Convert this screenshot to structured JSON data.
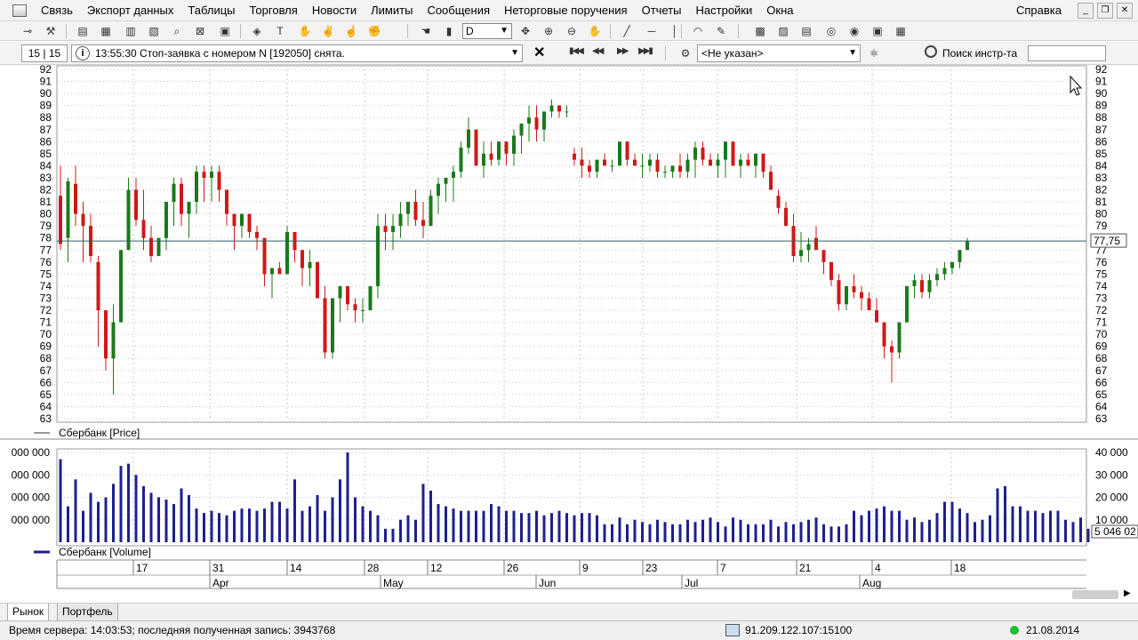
{
  "menu": {
    "items": [
      "Связь",
      "Экспорт данных",
      "Таблицы",
      "Торговля",
      "Новости",
      "Лимиты",
      "Сообщения",
      "Неторговые поручения",
      "Отчеты",
      "Настройки",
      "Окна"
    ],
    "help": "Справка"
  },
  "toolbar": {
    "timeframe": "D"
  },
  "toolbar2": {
    "counter": "15 | 15",
    "message": "13:55:30 Стоп-заявка с номером N [192050] снята.",
    "trader_select": "<Не указан>",
    "search_label": "Поиск инстр-та",
    "search_value": ""
  },
  "colors": {
    "bull": "#1a7a1a",
    "bear": "#d01818",
    "volume": "#1f1f8f",
    "grid": "#c8c8c8",
    "price_line": "#2f5f5f"
  },
  "chart_data": [
    {
      "type": "candlestick",
      "title": "Сбербанк [Price]",
      "ylim": [
        63,
        92
      ],
      "y_ticks": [
        63,
        64,
        65,
        66,
        67,
        68,
        69,
        70,
        71,
        72,
        73,
        74,
        75,
        76,
        77,
        78,
        79,
        80,
        81,
        82,
        83,
        84,
        85,
        86,
        87,
        88,
        89,
        90,
        91,
        92
      ],
      "current_price_label": "77,75",
      "current_price": 77.75,
      "ohlc": [
        [
          81.5,
          84,
          77,
          77.5
        ],
        [
          78,
          83,
          76,
          82.7
        ],
        [
          82.5,
          84,
          79,
          80
        ],
        [
          80,
          81,
          76,
          79
        ],
        [
          79,
          80,
          76,
          76.5
        ],
        [
          76,
          76.5,
          69,
          72
        ],
        [
          72,
          72,
          67,
          68
        ],
        [
          68,
          72.5,
          65,
          71
        ],
        [
          71,
          77,
          71,
          77
        ],
        [
          77,
          83,
          77,
          82
        ],
        [
          82,
          83,
          79,
          79.5
        ],
        [
          79.5,
          82,
          77,
          78
        ],
        [
          78,
          79,
          76,
          76.5
        ],
        [
          76.5,
          78,
          77,
          78
        ],
        [
          78,
          81,
          77,
          81
        ],
        [
          81,
          83,
          79,
          82.5
        ],
        [
          82.5,
          83,
          79,
          80
        ],
        [
          80,
          81,
          78,
          81
        ],
        [
          81,
          84,
          80,
          83.5
        ],
        [
          83.5,
          84,
          81,
          83
        ],
        [
          83,
          84,
          81,
          83.5
        ],
        [
          83.5,
          84,
          81,
          82
        ],
        [
          82,
          82,
          79,
          80
        ],
        [
          80,
          80,
          77,
          79
        ],
        [
          79,
          80,
          78,
          80
        ],
        [
          80,
          80,
          78,
          78.5
        ],
        [
          78.5,
          79,
          77,
          78
        ],
        [
          78,
          78,
          74,
          75
        ],
        [
          75,
          75.5,
          73,
          75.5
        ],
        [
          75.5,
          76,
          75,
          75
        ],
        [
          75,
          79,
          75,
          78.5
        ],
        [
          78.5,
          78.5,
          76,
          77
        ],
        [
          77,
          77,
          74,
          75.5
        ],
        [
          75.5,
          77,
          74,
          76
        ],
        [
          76,
          76,
          73,
          73
        ],
        [
          73,
          74,
          68,
          68.5
        ],
        [
          68.5,
          73,
          68,
          73
        ],
        [
          73,
          74,
          71,
          74
        ],
        [
          74,
          74,
          72,
          72.5
        ],
        [
          72.5,
          73,
          71,
          72
        ],
        [
          72,
          73,
          71,
          72
        ],
        [
          72,
          74,
          72,
          74
        ],
        [
          74,
          80,
          73,
          79
        ],
        [
          79,
          80,
          77,
          78.5
        ],
        [
          78.5,
          80,
          77,
          79
        ],
        [
          79,
          81,
          78,
          80
        ],
        [
          80,
          81,
          79,
          81
        ],
        [
          81,
          82,
          79,
          79.5
        ],
        [
          79.5,
          81,
          78,
          79
        ],
        [
          79,
          82,
          79,
          81.5
        ],
        [
          81.5,
          83,
          80,
          82.5
        ],
        [
          82.5,
          83,
          81,
          83
        ],
        [
          83,
          84,
          81,
          83.5
        ],
        [
          83.5,
          86,
          83,
          85.5
        ],
        [
          85.5,
          88,
          85,
          87
        ],
        [
          87,
          87,
          84,
          84
        ],
        [
          84,
          86,
          83,
          85
        ],
        [
          85,
          86,
          84,
          84.5
        ],
        [
          84.5,
          86,
          84,
          86
        ],
        [
          86,
          86,
          84,
          85
        ],
        [
          85,
          87,
          84,
          86.5
        ],
        [
          86.5,
          87,
          85,
          87.5
        ],
        [
          87.5,
          89,
          86,
          88
        ],
        [
          88,
          89,
          86,
          87
        ],
        [
          87,
          88,
          86,
          88.5
        ],
        [
          88.5,
          89.5,
          88,
          89
        ],
        [
          89,
          89,
          88,
          88.5
        ],
        [
          88.5,
          89,
          88,
          88.5
        ],
        [
          85,
          85.5,
          84,
          84.5
        ],
        [
          84.5,
          85.5,
          83,
          84
        ],
        [
          84,
          84.5,
          83,
          83.5
        ],
        [
          83.5,
          84,
          83,
          84.5
        ],
        [
          84.5,
          85,
          84,
          84
        ],
        [
          84,
          84.5,
          83.5,
          84
        ],
        [
          84,
          86,
          84,
          86
        ],
        [
          86,
          86,
          84,
          84.5
        ],
        [
          84.5,
          85,
          84,
          84
        ],
        [
          84,
          85,
          83,
          84
        ],
        [
          84,
          85,
          83.5,
          84.5
        ],
        [
          84.5,
          85,
          83,
          83.5
        ],
        [
          83.5,
          84,
          83,
          83.5
        ],
        [
          83.5,
          84,
          83,
          84
        ],
        [
          84,
          85,
          83,
          83.5
        ],
        [
          83.5,
          85,
          83,
          84.5
        ],
        [
          84.5,
          86,
          83,
          85.5
        ],
        [
          85.5,
          86,
          84,
          84.5
        ],
        [
          84.5,
          85,
          84,
          84
        ],
        [
          84,
          85,
          83,
          84.5
        ],
        [
          84.5,
          86,
          83,
          86
        ],
        [
          86,
          86,
          84,
          84
        ],
        [
          84,
          85,
          83,
          84.5
        ],
        [
          84.5,
          85,
          84,
          84
        ],
        [
          84,
          85,
          83,
          85
        ],
        [
          85,
          85,
          83,
          83.5
        ],
        [
          83.5,
          84,
          82,
          82
        ],
        [
          81.5,
          82,
          80,
          80.5
        ],
        [
          80.5,
          81,
          79,
          79
        ],
        [
          79,
          80,
          76,
          76.5
        ],
        [
          76.5,
          78.5,
          76,
          77
        ],
        [
          77,
          78,
          76,
          77.5
        ],
        [
          78,
          79,
          77,
          77
        ],
        [
          77,
          77,
          75,
          76
        ],
        [
          76,
          76,
          74,
          74.5
        ],
        [
          74.5,
          75,
          72,
          72.5
        ],
        [
          72.5,
          74,
          72,
          74
        ],
        [
          74,
          75,
          73,
          73.5
        ],
        [
          73.5,
          74,
          72,
          73
        ],
        [
          73,
          73.5,
          72,
          72
        ],
        [
          72,
          73,
          71,
          71
        ],
        [
          71,
          71,
          68,
          69
        ],
        [
          69,
          69.5,
          66,
          68.5
        ],
        [
          68.5,
          71,
          68,
          71
        ],
        [
          71,
          74,
          71,
          74
        ],
        [
          74,
          75,
          73,
          74.5
        ],
        [
          74.5,
          75,
          73,
          73.5
        ],
        [
          73.5,
          75,
          73,
          74.5
        ],
        [
          74.5,
          75.5,
          74,
          75
        ],
        [
          75,
          76,
          74.5,
          75.5
        ],
        [
          75.5,
          76,
          75,
          76
        ],
        [
          76,
          77,
          75.5,
          77
        ],
        [
          77,
          78,
          77,
          77.75
        ]
      ]
    },
    {
      "type": "bar",
      "title": "Сбербанк [Volume]",
      "ylim": [
        0,
        40000000
      ],
      "left_ticks": [
        "000 000",
        "000 000",
        "000 000",
        "000 000"
      ],
      "right_ticks": [
        "40 000",
        "30 000",
        "20 000",
        "10 000"
      ],
      "current_label": "5 046 02",
      "values": [
        37,
        16,
        28,
        14,
        22,
        18,
        20,
        26,
        34,
        35,
        30,
        25,
        22,
        20,
        19,
        17,
        24,
        21,
        15,
        13,
        14,
        13,
        12,
        14,
        15,
        15,
        14,
        15,
        18,
        18,
        15,
        28,
        14,
        16,
        21,
        14,
        20,
        28,
        40,
        20,
        16,
        14,
        12,
        6,
        6,
        10,
        12,
        10,
        26,
        23,
        17,
        16,
        15,
        14,
        14,
        14,
        14,
        17,
        16,
        14,
        14,
        13,
        13,
        14,
        12,
        13,
        14,
        13,
        12,
        13,
        13,
        12,
        8,
        8,
        11,
        8,
        10,
        9,
        8,
        10,
        9,
        8,
        8,
        10,
        9,
        10,
        11,
        9,
        7,
        11,
        10,
        8,
        8,
        8,
        10,
        7,
        9,
        8,
        9,
        10,
        11,
        8,
        7,
        7,
        8,
        14,
        12,
        14,
        15,
        16,
        14,
        14,
        10,
        11,
        9,
        10,
        13,
        18,
        18,
        15,
        13,
        9,
        10,
        12,
        24,
        25,
        16,
        16,
        14,
        14,
        13,
        14,
        14,
        10,
        9,
        11,
        6
      ]
    }
  ],
  "x_axis": {
    "day_labels": [
      "17",
      "31",
      "14",
      "28",
      "12",
      "26",
      "9",
      "23",
      "7",
      "21",
      "4",
      "18"
    ],
    "month_labels": [
      "Apr",
      "May",
      "Jun",
      "Jul",
      "Aug"
    ]
  },
  "tabs": [
    "Рынок",
    "Портфель"
  ],
  "status": {
    "server_text": "Время сервера: 14:03:53; последняя полученная запись: 3943768",
    "ip": "91.209.122.107:15100",
    "date": "21.08.2014"
  }
}
